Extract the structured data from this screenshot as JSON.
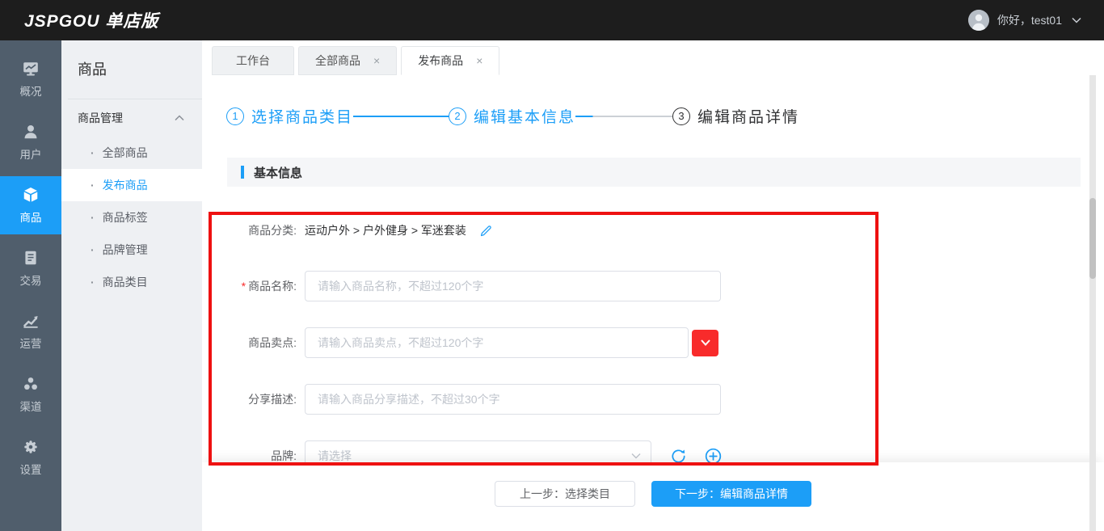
{
  "header": {
    "logo": "JSPGOU 单店版",
    "greeting": "你好，test01"
  },
  "sidebar": {
    "items": [
      {
        "label": "概况",
        "icon": "monitor-chart-icon",
        "active": false
      },
      {
        "label": "用户",
        "icon": "user-icon",
        "active": false
      },
      {
        "label": "商品",
        "icon": "cube-icon",
        "active": true
      },
      {
        "label": "交易",
        "icon": "document-icon",
        "active": false
      },
      {
        "label": "运营",
        "icon": "trend-chart-icon",
        "active": false
      },
      {
        "label": "渠道",
        "icon": "nodes-icon",
        "active": false
      },
      {
        "label": "设置",
        "icon": "gear-icon",
        "active": false
      }
    ]
  },
  "submenu": {
    "title": "商品",
    "group_label": "商品管理",
    "items": [
      {
        "label": "全部商品",
        "active": false
      },
      {
        "label": "发布商品",
        "active": true
      },
      {
        "label": "商品标签",
        "active": false
      },
      {
        "label": "品牌管理",
        "active": false
      },
      {
        "label": "商品类目",
        "active": false
      }
    ]
  },
  "tabs": [
    {
      "label": "工作台",
      "closable": false,
      "active": false
    },
    {
      "label": "全部商品",
      "closable": true,
      "active": false
    },
    {
      "label": "发布商品",
      "closable": true,
      "active": true
    }
  ],
  "steps": [
    {
      "number": "1",
      "label": "选择商品类目",
      "state": "done"
    },
    {
      "number": "2",
      "label": "编辑基本信息",
      "state": "active"
    },
    {
      "number": "3",
      "label": "编辑商品详情",
      "state": "pending"
    }
  ],
  "form": {
    "section_title": "基本信息",
    "category": {
      "label": "商品分类:",
      "value": "运动户外 > 户外健身 > 军迷套装"
    },
    "name": {
      "required_mark": "*",
      "label": "商品名称:",
      "placeholder": "请输入商品名称，不超过120个字",
      "value": ""
    },
    "selling_point": {
      "label": "商品卖点:",
      "placeholder": "请输入商品卖点，不超过120个字",
      "value": ""
    },
    "share_desc": {
      "label": "分享描述:",
      "placeholder": "请输入商品分享描述，不超过30个字",
      "value": ""
    },
    "brand": {
      "label": "品牌:",
      "placeholder": "请选择"
    }
  },
  "footer": {
    "prev_label": "上一步：选择类目",
    "next_label": "下一步：编辑商品详情"
  },
  "colors": {
    "accent": "#1c9ef7",
    "danger_red": "#f82b2b",
    "annotation_red": "#ee1111",
    "header_bg": "#1d1d1d",
    "sidebar_bg": "#505e6c"
  }
}
